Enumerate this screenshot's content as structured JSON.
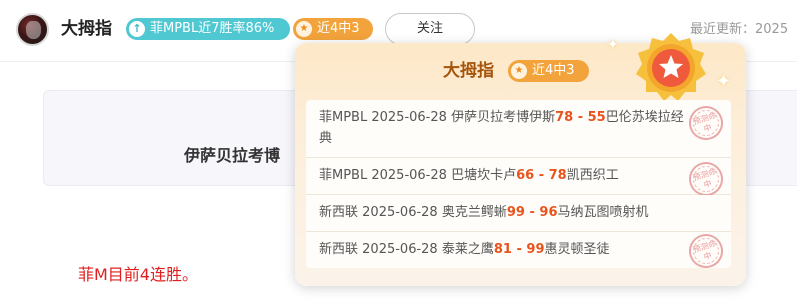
{
  "header": {
    "expert_name": "大拇指",
    "win_badge": "菲MPBL近7胜率86%",
    "streak_badge": "近4中3",
    "follow_label": "关注",
    "update_label": "最近更新：2025"
  },
  "card": {
    "title_fragment": "伊萨贝拉考博"
  },
  "note": "菲M目前4连胜。",
  "popup": {
    "title": "大拇指",
    "badge": "近4中3",
    "records": [
      {
        "league": "菲MPBL",
        "date": "2025-06-28",
        "home": "伊萨贝拉考博伊斯",
        "score": "78 - 55",
        "away": "巴伦苏埃拉经典",
        "stamp": "预测命中"
      },
      {
        "league": "菲MPBL",
        "date": "2025-06-28",
        "home": "巴塘坎卡卢",
        "score": "66 - 78",
        "away": "凯西织工",
        "stamp": "预测命中"
      },
      {
        "league": "新西联",
        "date": "2025-06-28",
        "home": "奥克兰鳄蜥",
        "score": "99 - 96",
        "away": "马纳瓦图喷射机",
        "stamp": ""
      },
      {
        "league": "新西联",
        "date": "2025-06-28",
        "home": "泰莱之鹰",
        "score": "81 - 99",
        "away": "惠灵顿圣徒",
        "stamp": "预测命中"
      }
    ]
  },
  "icons": {
    "win_badge_icon": "arrow-up-icon",
    "streak_icon": "star-icon",
    "medal_icon": "star-medal-icon"
  },
  "colors": {
    "win_badge": "#50c8d2",
    "streak_badge": "#f3a33c",
    "score": "#e8541c",
    "note": "#e02020",
    "popup_title": "#a5540b"
  }
}
